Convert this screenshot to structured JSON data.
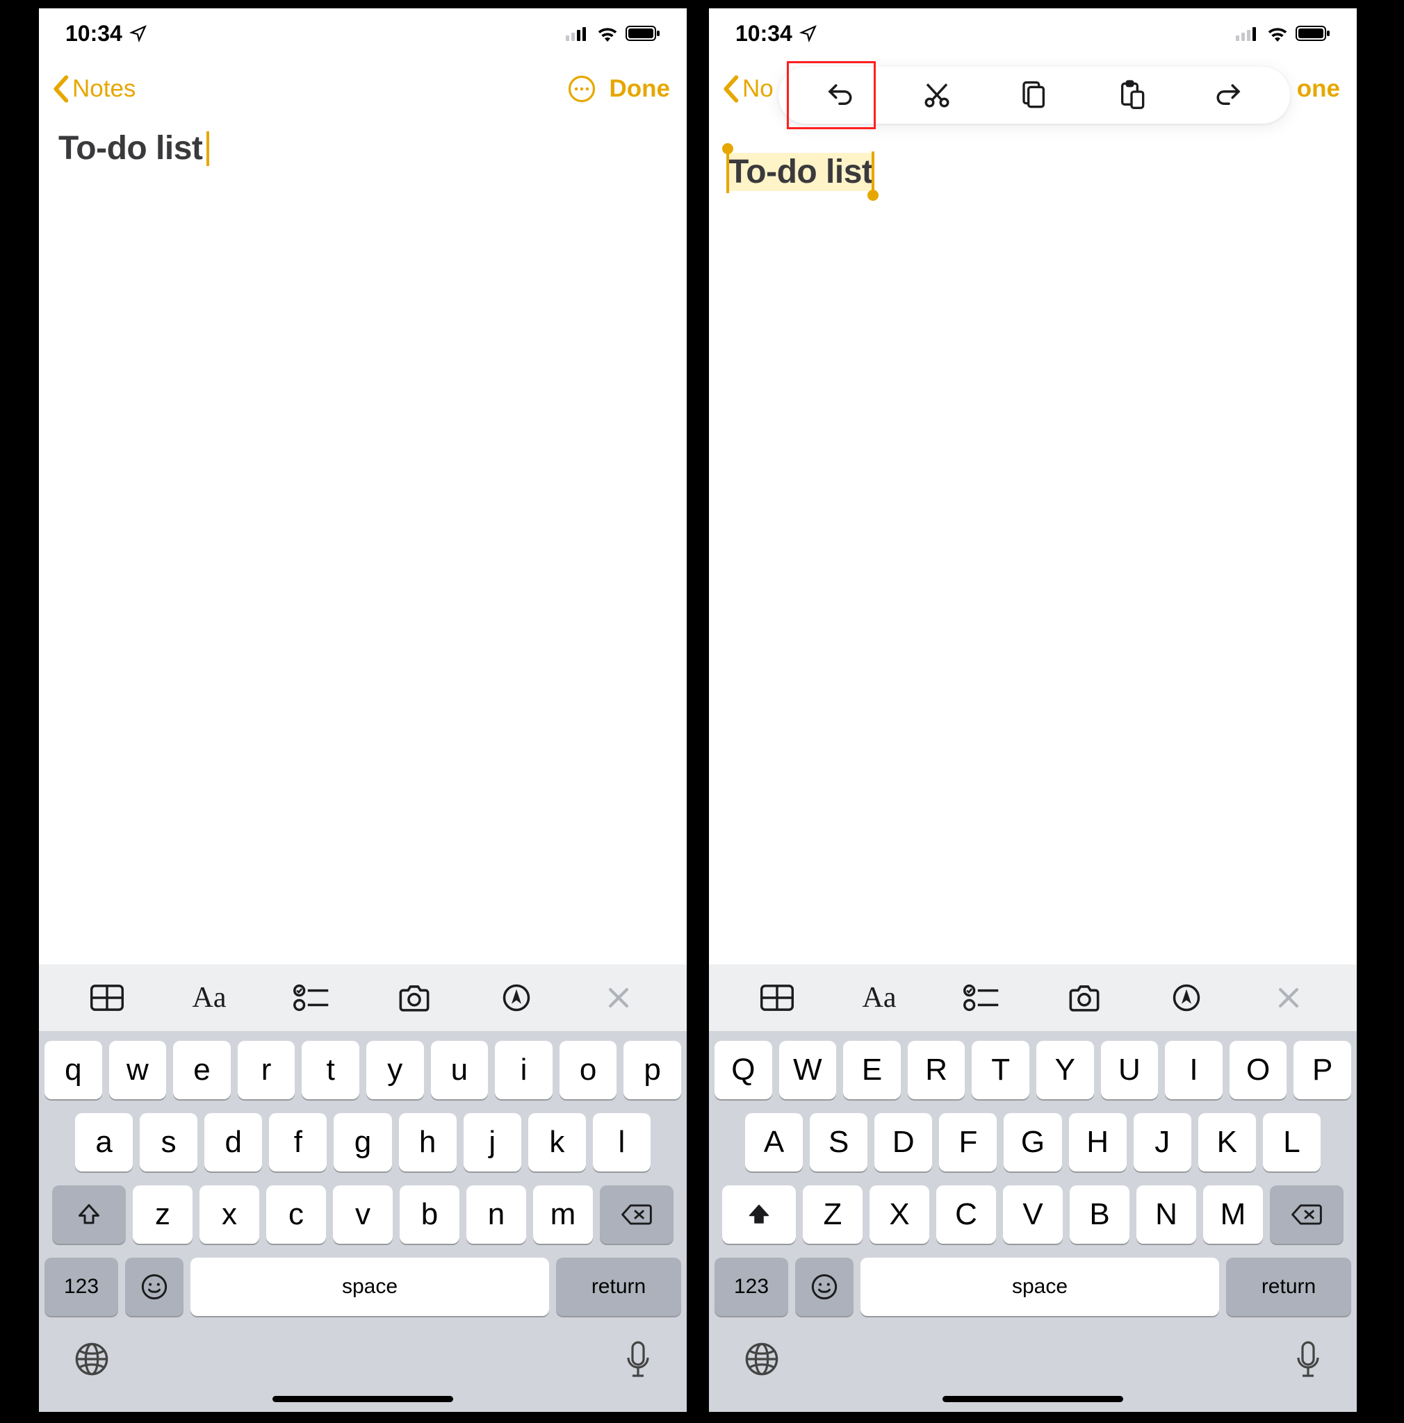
{
  "accent_color": "#e6a700",
  "status": {
    "time": "10:34"
  },
  "nav": {
    "back_label": "Notes",
    "done_label": "Done",
    "back_label_2": "No",
    "done_label_2": "one"
  },
  "note": {
    "title": "To-do list"
  },
  "keyboard": {
    "row1_lower": [
      "q",
      "w",
      "e",
      "r",
      "t",
      "y",
      "u",
      "i",
      "o",
      "p"
    ],
    "row2_lower": [
      "a",
      "s",
      "d",
      "f",
      "g",
      "h",
      "j",
      "k",
      "l"
    ],
    "row3_lower": [
      "z",
      "x",
      "c",
      "v",
      "b",
      "n",
      "m"
    ],
    "row1_upper": [
      "Q",
      "W",
      "E",
      "R",
      "T",
      "Y",
      "U",
      "I",
      "O",
      "P"
    ],
    "row2_upper": [
      "A",
      "S",
      "D",
      "F",
      "G",
      "H",
      "J",
      "K",
      "L"
    ],
    "row3_upper": [
      "Z",
      "X",
      "C",
      "V",
      "B",
      "N",
      "M"
    ],
    "numeric_label": "123",
    "space_label": "space",
    "return_label": "return"
  },
  "accessory": [
    "table",
    "text-format",
    "checklist",
    "camera",
    "markup",
    "close"
  ],
  "context_menu": [
    "undo",
    "cut",
    "copy",
    "paste",
    "redo"
  ]
}
